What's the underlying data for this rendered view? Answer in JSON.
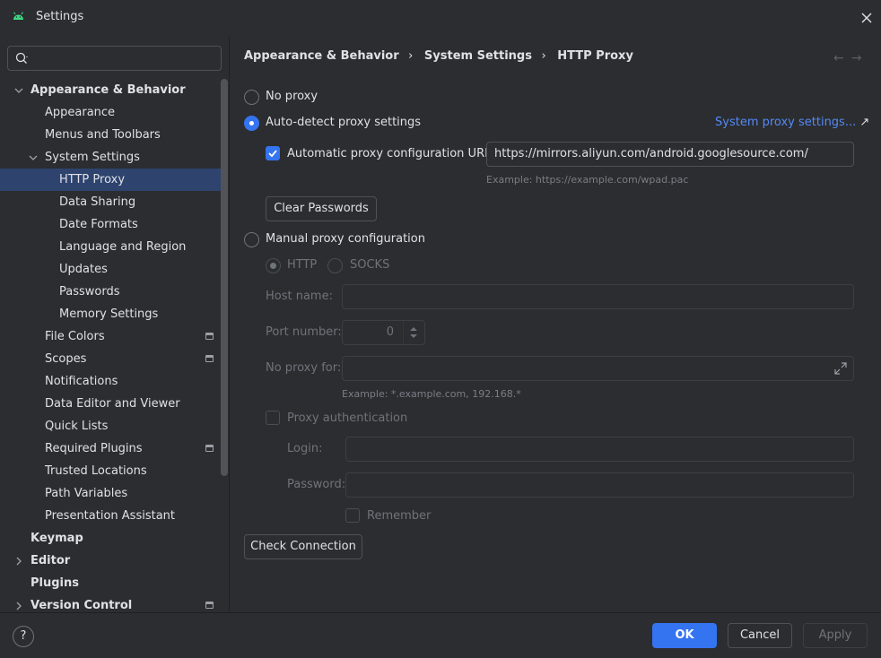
{
  "window": {
    "title": "Settings"
  },
  "search": {
    "placeholder": ""
  },
  "sidebar": {
    "items": [
      {
        "label": "Appearance & Behavior",
        "level": 0,
        "bold": true,
        "chevron": "down"
      },
      {
        "label": "Appearance",
        "level": 1
      },
      {
        "label": "Menus and Toolbars",
        "level": 1
      },
      {
        "label": "System Settings",
        "level": 1,
        "chevron": "down"
      },
      {
        "label": "HTTP Proxy",
        "level": 2,
        "selected": true
      },
      {
        "label": "Data Sharing",
        "level": 2
      },
      {
        "label": "Date Formats",
        "level": 2
      },
      {
        "label": "Language and Region",
        "level": 2
      },
      {
        "label": "Updates",
        "level": 2
      },
      {
        "label": "Passwords",
        "level": 2
      },
      {
        "label": "Memory Settings",
        "level": 2
      },
      {
        "label": "File Colors",
        "level": 1,
        "project_icon": true
      },
      {
        "label": "Scopes",
        "level": 1,
        "project_icon": true
      },
      {
        "label": "Notifications",
        "level": 1
      },
      {
        "label": "Data Editor and Viewer",
        "level": 1
      },
      {
        "label": "Quick Lists",
        "level": 1
      },
      {
        "label": "Required Plugins",
        "level": 1,
        "project_icon": true
      },
      {
        "label": "Trusted Locations",
        "level": 1
      },
      {
        "label": "Path Variables",
        "level": 1
      },
      {
        "label": "Presentation Assistant",
        "level": 1
      },
      {
        "label": "Keymap",
        "level": 0,
        "bold": true
      },
      {
        "label": "Editor",
        "level": 0,
        "bold": true,
        "chevron": "right"
      },
      {
        "label": "Plugins",
        "level": 0,
        "bold": true
      },
      {
        "label": "Version Control",
        "level": 0,
        "bold": true,
        "chevron": "right",
        "project_icon": true
      }
    ]
  },
  "breadcrumb": {
    "part1": "Appearance & Behavior",
    "part2": "System Settings",
    "part3": "HTTP Proxy",
    "separator": "›"
  },
  "proxy": {
    "no_proxy": "No proxy",
    "auto_detect": "Auto-detect proxy settings",
    "system_link": "System proxy settings...",
    "auto_url_label": "Automatic proxy configuration URL:",
    "auto_url_value": "https://mirrors.aliyun.com/android.googlesource.com/",
    "auto_url_hint": "Example: https://example.com/wpad.pac",
    "clear_passwords": "Clear Passwords",
    "manual": "Manual proxy configuration",
    "http": "HTTP",
    "socks": "SOCKS",
    "host_label": "Host name:",
    "host_value": "",
    "port_label": "Port number:",
    "port_value": "0",
    "no_proxy_for_label": "No proxy for:",
    "no_proxy_for_value": "",
    "no_proxy_hint": "Example: *.example.com, 192.168.*",
    "proxy_auth": "Proxy authentication",
    "login_label": "Login:",
    "login_value": "",
    "password_label": "Password:",
    "password_value": "",
    "remember": "Remember",
    "check_connection": "Check Connection"
  },
  "footer": {
    "help": "?",
    "ok": "OK",
    "cancel": "Cancel",
    "apply": "Apply"
  },
  "colors": {
    "accent": "#3574f0",
    "selection": "#2e436e",
    "link": "#548af7",
    "background": "#2b2d30"
  }
}
